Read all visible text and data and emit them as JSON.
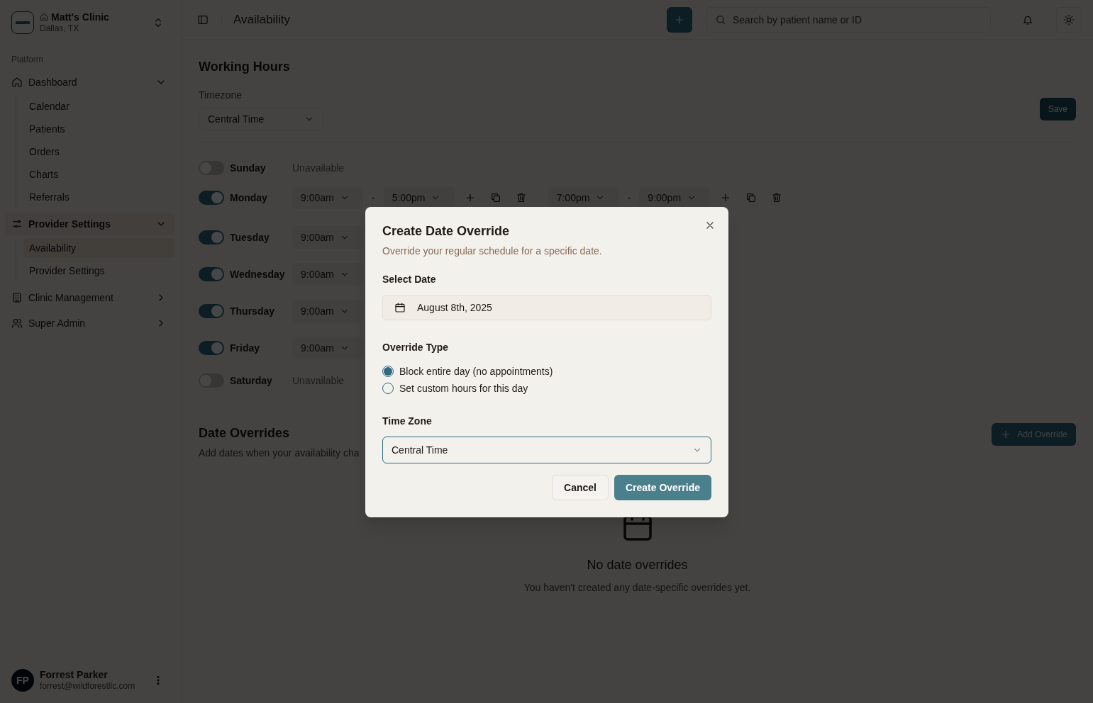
{
  "sidebar": {
    "clinic": {
      "name": "Matt's Clinic",
      "location": "Dallas, TX"
    },
    "section_label": "Platform",
    "nav": [
      {
        "label": "Dashboard",
        "expanded": true,
        "selected": false,
        "children": [
          {
            "label": "Calendar",
            "selected": false
          },
          {
            "label": "Patients",
            "selected": false
          },
          {
            "label": "Orders",
            "selected": false
          },
          {
            "label": "Charts",
            "selected": false
          },
          {
            "label": "Referrals",
            "selected": false
          }
        ]
      },
      {
        "label": "Provider Settings",
        "expanded": true,
        "selected": true,
        "children": [
          {
            "label": "Availability",
            "selected": true
          },
          {
            "label": "Provider Settings",
            "selected": false
          }
        ]
      },
      {
        "label": "Clinic Management",
        "expanded": false,
        "selected": false
      },
      {
        "label": "Super Admin",
        "expanded": false,
        "selected": false
      }
    ],
    "user": {
      "initials": "FP",
      "name": "Forrest Parker",
      "email": "forrest@wildforestllc.com"
    }
  },
  "header": {
    "title": "Availability",
    "search": {
      "placeholder": "Search by patient name or ID"
    }
  },
  "working_hours": {
    "title": "Working Hours",
    "timezone_label": "Timezone",
    "timezone": "Central Time",
    "save_label": "Save",
    "separator": "-",
    "days": [
      {
        "name": "Sunday",
        "on": false,
        "note": "Unavailable"
      },
      {
        "name": "Monday",
        "on": true,
        "ranges": [
          {
            "start": "9:00am",
            "end": "5:00pm"
          },
          {
            "start": "7:00pm",
            "end": "9:00pm"
          }
        ]
      },
      {
        "name": "Tuesday",
        "on": true,
        "ranges": [
          {
            "start": "9:00am"
          }
        ]
      },
      {
        "name": "Wednesday",
        "on": true,
        "ranges": [
          {
            "start": "9:00am"
          }
        ]
      },
      {
        "name": "Thursday",
        "on": true,
        "ranges": [
          {
            "start": "9:00am"
          }
        ]
      },
      {
        "name": "Friday",
        "on": true,
        "ranges": [
          {
            "start": "9:00am"
          }
        ]
      },
      {
        "name": "Saturday",
        "on": false,
        "note": "Unavailable"
      }
    ]
  },
  "date_overrides": {
    "title": "Date Overrides",
    "description": "Add dates when your availability cha",
    "add_label": "Add Override",
    "empty_title": "No date overrides",
    "empty_text": "You haven't created any date-specific overrides yet."
  },
  "dialog": {
    "title": "Create Date Override",
    "description": "Override your regular schedule for a specific date.",
    "date_label": "Select Date",
    "date_value": "August 8th, 2025",
    "type_label": "Override Type",
    "options": [
      {
        "label": "Block entire day (no appointments)",
        "selected": true
      },
      {
        "label": "Set custom hours for this day",
        "selected": false
      }
    ],
    "timezone_label": "Time Zone",
    "timezone": "Central Time",
    "cancel_label": "Cancel",
    "submit_label": "Create Override"
  }
}
